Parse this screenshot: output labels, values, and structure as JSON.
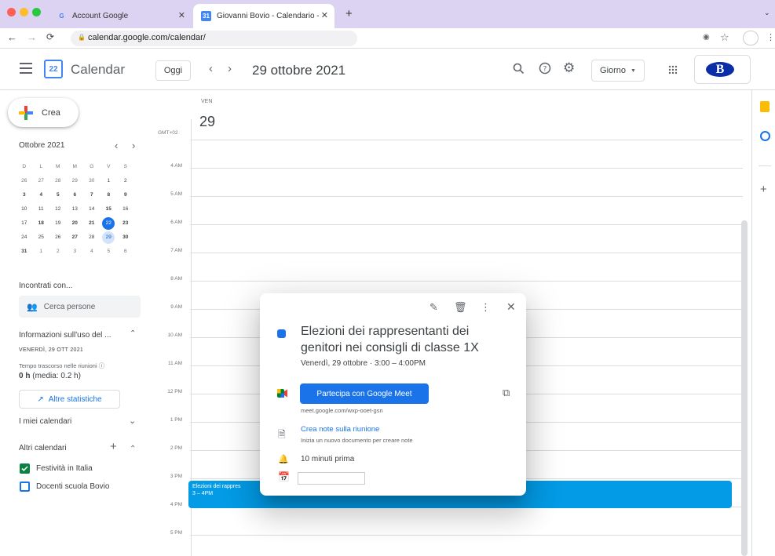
{
  "browser": {
    "tabs": [
      {
        "title": "Account Google",
        "favicon": "G"
      },
      {
        "title": "Giovanni Bovio - Calendario - ",
        "favicon": "31"
      }
    ],
    "new_tab": "+",
    "url": "calendar.google.com/calendar/",
    "colors": {
      "tabbar": "#dcd3f2",
      "close_dot": "#ff5f57",
      "min_dot": "#febc2e",
      "max_dot": "#28c840"
    }
  },
  "header": {
    "app_name": "Calendar",
    "logo_day": "22",
    "today_button": "Oggi",
    "date_title": "29 ottobre 2021",
    "view_select": "Giorno",
    "avatar_letter": "B"
  },
  "sidebar": {
    "create_label": "Crea",
    "mini_calendar": {
      "month": "Ottobre 2021",
      "weekdays": [
        "D",
        "L",
        "M",
        "M",
        "G",
        "V",
        "S"
      ],
      "weeks": [
        [
          "26",
          "27",
          "28",
          "29",
          "30",
          "1",
          "2"
        ],
        [
          "3",
          "4",
          "5",
          "6",
          "7",
          "8",
          "9"
        ],
        [
          "10",
          "11",
          "12",
          "13",
          "14",
          "15",
          "16"
        ],
        [
          "17",
          "18",
          "19",
          "20",
          "21",
          "22",
          "23"
        ],
        [
          "24",
          "25",
          "26",
          "27",
          "28",
          "29",
          "30"
        ],
        [
          "31",
          "1",
          "2",
          "3",
          "4",
          "5",
          "6"
        ]
      ],
      "selected_day": "22",
      "highlighted_day": "29"
    },
    "meet_with": "Incontrati con...",
    "search_people_placeholder": "Cerca persone",
    "insights_title": "Informazioni sull'uso del ...",
    "insights_date": "VENERDÌ, 29 OTT 2021",
    "meeting_time_label": "Tempo trascorso nelle riunioni",
    "meeting_time_value": "0 h",
    "meeting_time_avg": "(media: 0.2 h)",
    "stats_button": "Altre statistiche",
    "my_calendars": "I miei calendari",
    "other_calendars": "Altri calendari",
    "calendars": [
      {
        "name": "Festività in Italia",
        "checked": true,
        "color": "#0b8043"
      },
      {
        "name": "Docenti scuola Bovio",
        "checked": false,
        "color": "#1a73e8"
      }
    ]
  },
  "day_view": {
    "weekday": "VEN",
    "day": "29",
    "timezone": "GMT+02",
    "hours": [
      "4 AM",
      "5 AM",
      "6 AM",
      "7 AM",
      "8 AM",
      "9 AM",
      "10 AM",
      "11 AM",
      "12 PM",
      "1 PM",
      "2 PM",
      "3 PM",
      "4 PM",
      "5 PM"
    ],
    "event": {
      "title": "Elezioni dei rappresentanti dei genitori nei consigli di classe 1X",
      "short_title": "Elezioni dei rappres",
      "time": "3 – 4PM",
      "color": "#039be5"
    }
  },
  "popup": {
    "title": "Elezioni dei rappresentanti dei genitori nei consigli di classe 1X",
    "datetime": "Venerdì, 29 ottobre  ·  3:00 – 4:00PM",
    "meet_button": "Partecipa con Google Meet",
    "meet_link": "meet.google.com/wxp-ooet-gsn",
    "notes_link": "Crea note sulla riunione",
    "notes_desc": "Inizia un nuovo documento per creare note",
    "reminder": "10 minuti prima",
    "event_color": "#1a73e8"
  }
}
